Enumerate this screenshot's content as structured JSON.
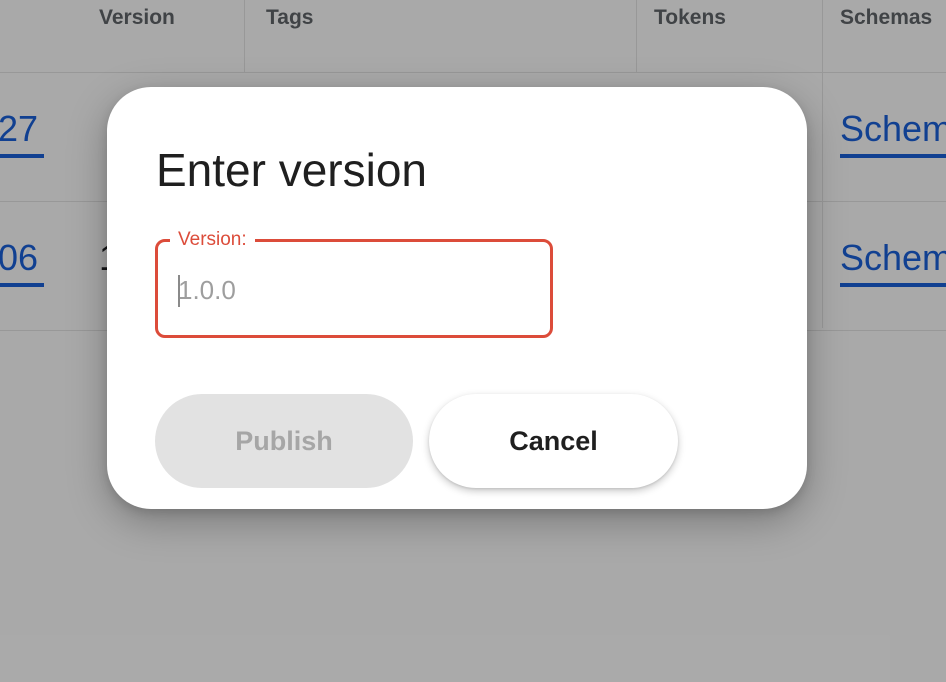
{
  "table": {
    "headers": {
      "version": "Version",
      "tags": "Tags",
      "tokens": "Tokens",
      "schemas": "Schemas"
    },
    "rows": [
      {
        "id_fragment": "27",
        "schemas_link": "Schemas"
      },
      {
        "id_fragment": "06",
        "version_fragment": "1",
        "schemas_link": "Schemas"
      }
    ]
  },
  "dialog": {
    "title": "Enter version",
    "version_field": {
      "label": "Version:",
      "placeholder": "1.0.0",
      "value": ""
    },
    "publish_label": "Publish",
    "cancel_label": "Cancel"
  },
  "colors": {
    "accent_error": "#dc4c3a",
    "link": "#1a5fd6",
    "disabled_bg": "#e2e2e2",
    "disabled_text": "#a6a6a6"
  }
}
